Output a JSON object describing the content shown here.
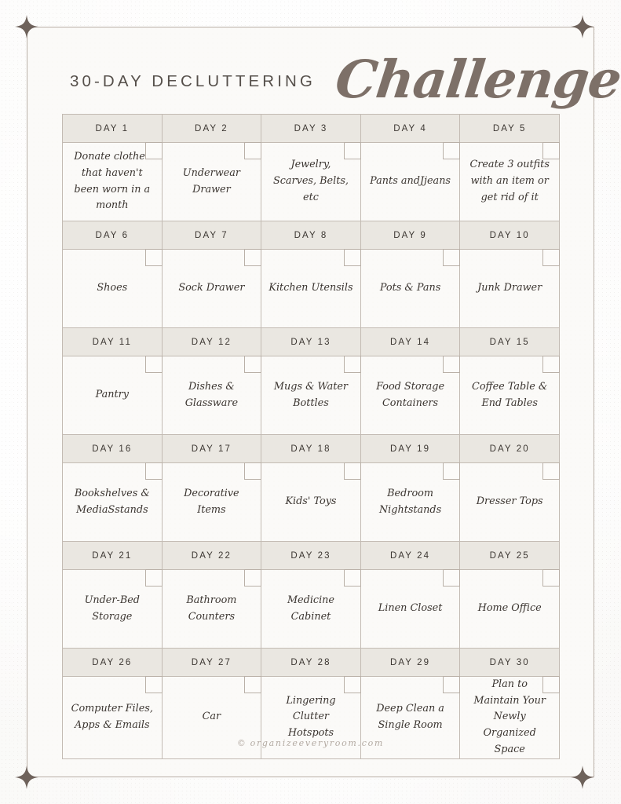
{
  "page": {
    "title_main": "30-DAY DECLUTTERING",
    "title_script": "Challenge",
    "footer_mark": "©",
    "footer_text": "organizeeveryroom.com"
  },
  "theme": {
    "paper_bg": "#efece7",
    "sheet_bg": "#fbfaf8",
    "frame_line": "#b9afa6",
    "header_band": "#eae7e1",
    "grid_line": "#c3bbb3",
    "title_color": "#56504b",
    "script_color": "#7d7068",
    "task_color": "#3b3530",
    "footer_color": "#b3aaa2",
    "sparkle_color": "#6e625b"
  },
  "calendar": {
    "columns": 5,
    "rows": [
      {
        "days": [
          {
            "label": "DAY 1",
            "task": "Donate clothes that haven't been worn in a month",
            "checked": false
          },
          {
            "label": "DAY 2",
            "task": "Underwear Drawer",
            "checked": false
          },
          {
            "label": "DAY 3",
            "task": "Jewelry, Scarves, Belts, etc",
            "checked": false
          },
          {
            "label": "DAY 4",
            "task": "Pants andJjeans",
            "checked": false
          },
          {
            "label": "DAY 5",
            "task": "Create 3 outfits with an item or get rid of it",
            "checked": false
          }
        ]
      },
      {
        "days": [
          {
            "label": "DAY 6",
            "task": "Shoes",
            "checked": false
          },
          {
            "label": "DAY 7",
            "task": "Sock Drawer",
            "checked": false
          },
          {
            "label": "DAY 8",
            "task": "Kitchen Utensils",
            "checked": false
          },
          {
            "label": "DAY 9",
            "task": "Pots & Pans",
            "checked": false
          },
          {
            "label": "DAY 10",
            "task": "Junk Drawer",
            "checked": false
          }
        ]
      },
      {
        "days": [
          {
            "label": "DAY 11",
            "task": "Pantry",
            "checked": false
          },
          {
            "label": "DAY 12",
            "task": "Dishes & Glassware",
            "checked": false
          },
          {
            "label": "DAY 13",
            "task": "Mugs & Water Bottles",
            "checked": false
          },
          {
            "label": "DAY 14",
            "task": "Food Storage Containers",
            "checked": false
          },
          {
            "label": "DAY 15",
            "task": "Coffee Table & End Tables",
            "checked": false
          }
        ]
      },
      {
        "days": [
          {
            "label": "DAY 16",
            "task": "Bookshelves & MediaSstands",
            "checked": false
          },
          {
            "label": "DAY 17",
            "task": "Decorative Items",
            "checked": false
          },
          {
            "label": "DAY 18",
            "task": "Kids' Toys",
            "checked": false
          },
          {
            "label": "DAY 19",
            "task": "Bedroom Nightstands",
            "checked": false
          },
          {
            "label": "DAY 20",
            "task": "Dresser Tops",
            "checked": false
          }
        ]
      },
      {
        "days": [
          {
            "label": "DAY 21",
            "task": "Under-Bed Storage",
            "checked": false
          },
          {
            "label": "DAY 22",
            "task": "Bathroom Counters",
            "checked": false
          },
          {
            "label": "DAY 23",
            "task": "Medicine Cabinet",
            "checked": false
          },
          {
            "label": "DAY 24",
            "task": "Linen Closet",
            "checked": false
          },
          {
            "label": "DAY 25",
            "task": "Home Office",
            "checked": false
          }
        ]
      },
      {
        "days": [
          {
            "label": "DAY 26",
            "task": "Computer Files, Apps & Emails",
            "checked": false
          },
          {
            "label": "DAY 27",
            "task": "Car",
            "checked": false
          },
          {
            "label": "DAY 28",
            "task": "Lingering Clutter Hotspots",
            "checked": false
          },
          {
            "label": "DAY 29",
            "task": "Deep Clean a Single Room",
            "checked": false
          },
          {
            "label": "DAY 30",
            "task": "Plan to Maintain Your Newly Organized Space",
            "checked": false
          }
        ]
      }
    ]
  },
  "ornaments": [
    {
      "name": "sparkle-top-left"
    },
    {
      "name": "sparkle-top-right"
    },
    {
      "name": "sparkle-bottom-left"
    },
    {
      "name": "sparkle-bottom-right"
    }
  ]
}
